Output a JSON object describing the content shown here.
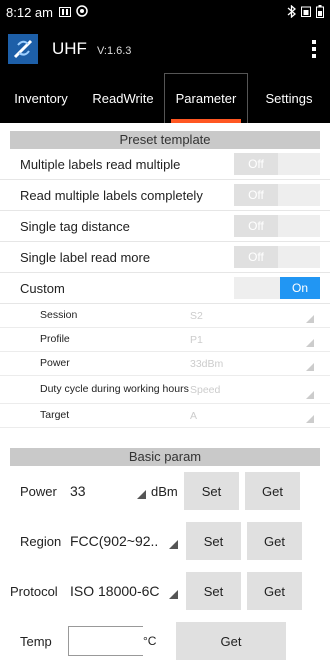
{
  "status": {
    "time": "8:12 am"
  },
  "app": {
    "title": "UHF",
    "version": "V:1.6.3"
  },
  "tabs": [
    "Inventory",
    "ReadWrite",
    "Parameter",
    "Settings"
  ],
  "preset": {
    "heading": "Preset template",
    "items": [
      {
        "label": "Multiple labels read multiple",
        "state": "Off"
      },
      {
        "label": "Read multiple labels completely",
        "state": "Off"
      },
      {
        "label": "Single tag distance",
        "state": "Off"
      },
      {
        "label": "Single label read more",
        "state": "Off"
      },
      {
        "label": "Custom",
        "state": "On"
      }
    ],
    "custom": [
      {
        "label": "Session",
        "value": "S2"
      },
      {
        "label": "Profile",
        "value": "P1"
      },
      {
        "label": "Power",
        "value": "33dBm"
      },
      {
        "label": "Duty cycle during working hours",
        "value": "Speed"
      },
      {
        "label": "Target",
        "value": "A"
      }
    ]
  },
  "basic": {
    "heading": "Basic param",
    "power": {
      "label": "Power",
      "value": "33",
      "unit": "dBm",
      "set": "Set",
      "get": "Get"
    },
    "region": {
      "label": "Region",
      "value": "FCC(902~92..",
      "set": "Set",
      "get": "Get"
    },
    "protocol": {
      "label": "Protocol",
      "value": "ISO 18000-6C",
      "set": "Set",
      "get": "Get"
    },
    "temp": {
      "label": "Temp",
      "unit": "°C",
      "get": "Get"
    }
  }
}
